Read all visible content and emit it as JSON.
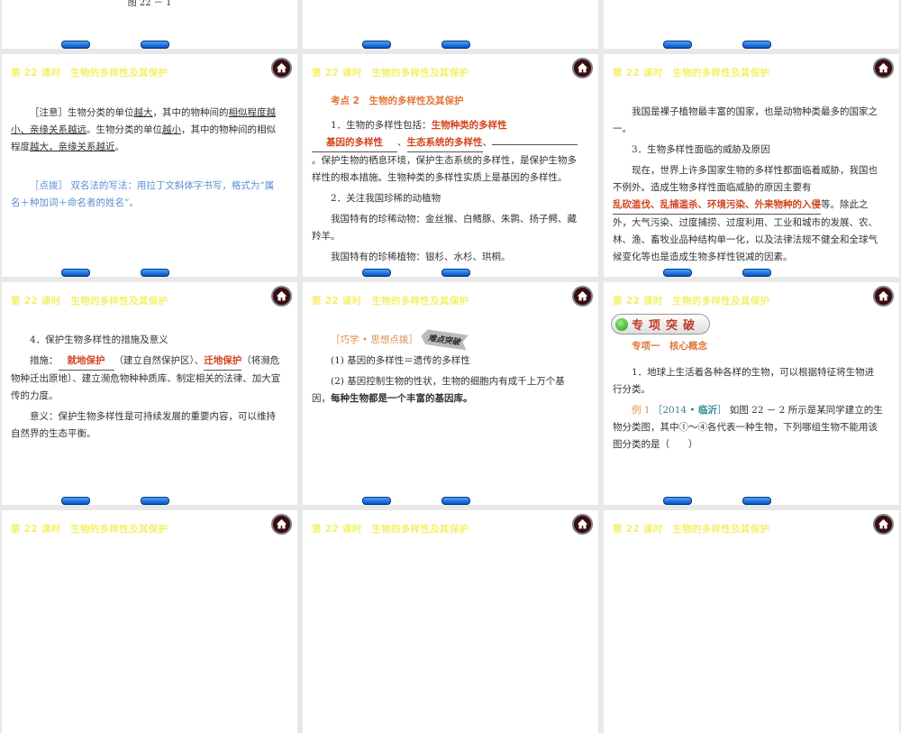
{
  "header_title": "第 22 课时　生物的多样性及其保护",
  "top_row": {
    "caption": "图 22 － 1"
  },
  "slide_a": {
    "note_tag": "［注意］",
    "t1": "生物分类的单位",
    "u1": "越大",
    "t2": "，其中的物种间的",
    "u2": "相似程度越小、亲缘关系越远",
    "t3": "。生物分类的单位",
    "u3": "越小",
    "t4": "，其中的物种间的相似程度",
    "u4": "越大，亲缘关系越近",
    "t5": "。",
    "tip": "［点拨］ 双名法的写法：用拉丁文斜体字书写，格式为“属名＋种加词＋命名者的姓名”。"
  },
  "slide_b": {
    "heading": "考点 2　生物的多样性及其保护",
    "p1_lead": "1．生物的多样性包括：",
    "ans1": "生物种类的多样性",
    "ans2": "基因的多样性",
    "ans3": "生态系统的多样性",
    "sep": "、",
    "p1_rest": "。保护生物的栖息环境，保护生态系统的多样性，是保护生物多样性的根本措施。生物种类的多样性实质上是基因的多样性。",
    "p2": "2．关注我国珍稀的动植物",
    "p3": "我国特有的珍稀动物：金丝猴、白鳍豚、朱鹮、扬子鳄、藏羚羊。",
    "p4": "我国特有的珍稀植物：银杉、水杉、珙桐。"
  },
  "slide_c": {
    "p1": "我国是裸子植物最丰富的国家，也是动物种类最多的国家之一。",
    "p2": "3．生物多样性面临的威胁及原因",
    "p3a": "现在，世界上许多国家生物的多样性都面临着威胁，我国也不例外。造成生物多样性面临威胁的原因主要有",
    "ans": "乱砍滥伐、乱捕滥杀、环境污染、外来物种的入侵",
    "p3b": "等。除此之外，大气污染、过度捕捞、过度利用、工业和城市的发展、农、林、渔、畜牧业品种结构单一化，以及法律法规不健全和全球气候变化等也是造成生物多样性锐减的因素。"
  },
  "slide_d": {
    "p1": "4．保护生物多样性的措施及意义",
    "lead": "措施：",
    "ans1": "就地保护",
    "mid": "（建立自然保护区）、",
    "ans2": "迁地保护",
    "rest": "（将濒危物种迁出原地）、建立濒危物种种质库、制定相关的法律、加大宣传的力度。",
    "p3": "意义：保护生物多样性是可持续发展的重要内容，可以维持自然界的生态平衡。"
  },
  "slide_e": {
    "tag": "［巧学 • 思想点拨］",
    "sign": "难点突破",
    "p1": "(1) 基因的多样性＝遗传的多样性",
    "p2a": "(2) 基因控制生物的性状，生物的细胞内有成千上万个基因，",
    "p2b": "每种生物都是一个丰富的基因库。"
  },
  "slide_f": {
    "badge": "专项突破",
    "sub": "专项一　核心概念",
    "p1": "1．地球上生活着各种各样的生物，可以根据特征将生物进行分类。",
    "ex_label": "例 1",
    "ex_src_a": "［2014 • ",
    "ex_src_b": "临沂",
    "ex_src_c": "］",
    "ex_text": " 如图 22 － 2 所示是某同学建立的生物分类图，其中①～④各代表一种生物，下列哪组生物不能用该图分类的是（　　）"
  }
}
